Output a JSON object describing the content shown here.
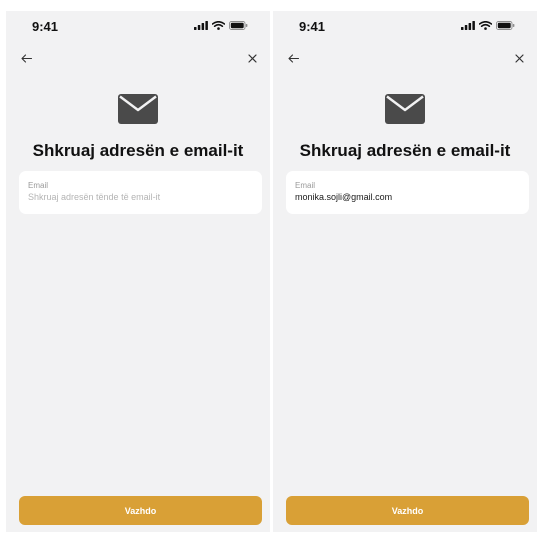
{
  "theme": {
    "screen_background": "#f2f2f3",
    "accent": "#d9a036",
    "icon_color": "#4a4a4a",
    "text_primary": "#111111",
    "placeholder_color": "#b4b4b4"
  },
  "screens": [
    {
      "status_bar": {
        "time": "9:41",
        "icons": [
          "signal-icon",
          "wifi-icon",
          "battery-icon"
        ]
      },
      "nav": {
        "back_icon": "arrow-left-icon",
        "close_icon": "close-icon"
      },
      "header_icon": "envelope-icon",
      "title": "Shkruaj adresën e email-it",
      "email_field": {
        "label": "Email",
        "value": "",
        "placeholder": "Shkruaj adresën tënde të email-it"
      },
      "continue_button": {
        "label": "Vazhdo"
      }
    },
    {
      "status_bar": {
        "time": "9:41",
        "icons": [
          "signal-icon",
          "wifi-icon",
          "battery-icon"
        ]
      },
      "nav": {
        "back_icon": "arrow-left-icon",
        "close_icon": "close-icon"
      },
      "header_icon": "envelope-icon",
      "title": "Shkruaj adresën e email-it",
      "email_field": {
        "label": "Email",
        "value": "monika.sojli@gmail.com",
        "placeholder": "Shkruaj adresën tënde të email-it"
      },
      "continue_button": {
        "label": "Vazhdo"
      }
    }
  ]
}
